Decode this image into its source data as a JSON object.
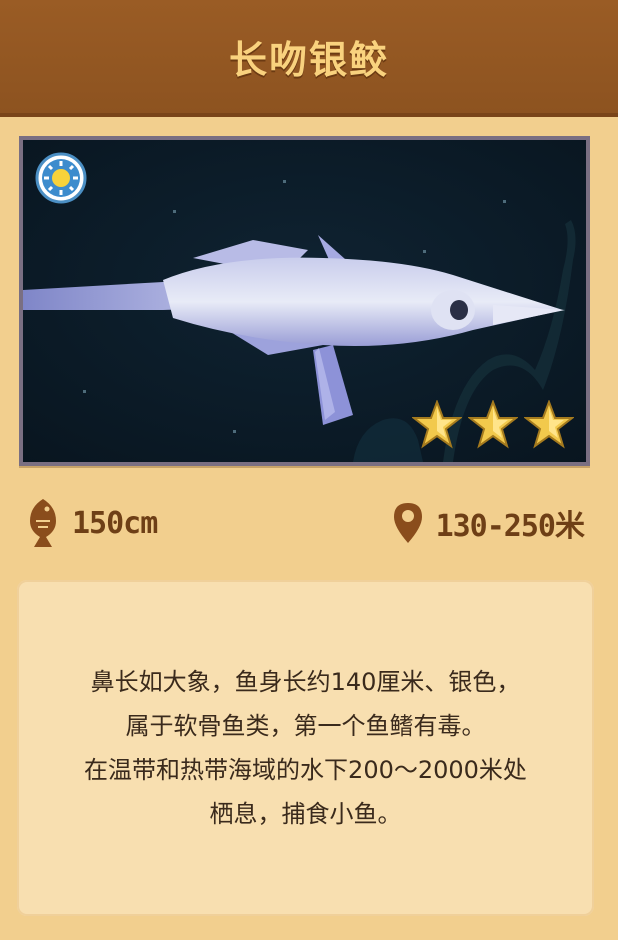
{
  "card": {
    "title": "长吻银鲛",
    "time_icon": "sun-clock-icon",
    "rarity_stars": 3,
    "rarity_max": 3,
    "length": "150cm",
    "length_icon": "fish-silhouette-icon",
    "depth": "130-250米",
    "depth_icon": "map-pin-icon",
    "description_lines": [
      "鼻长如大象，鱼身长约140厘米、银色，",
      "属于软骨鱼类，第一个鱼鳍有毒。",
      "在温带和热带海域的水下200～2000米处",
      "栖息，捕食小鱼。"
    ]
  },
  "colors": {
    "header": "#8d5320",
    "title_text": "#f9d27e",
    "card_bg": "#f2cf8e",
    "stat_text": "#6e3f16",
    "desc_bg": "#f8dfb0",
    "star": "#f2c94c"
  }
}
